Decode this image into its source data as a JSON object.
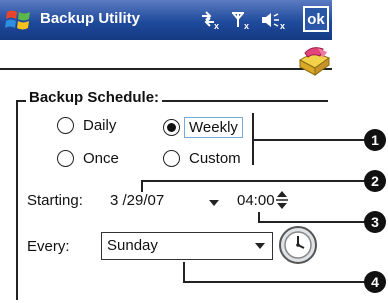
{
  "titlebar": {
    "title": "Backup Utility",
    "ok_label": "ok",
    "start_icon": "windows-flag-icon",
    "status_icons": [
      "connectivity-icon",
      "signal-icon",
      "volume-icon"
    ]
  },
  "header": {
    "icon": "backup-book-icon"
  },
  "schedule": {
    "group_label": "Backup Schedule:",
    "options": [
      {
        "label": "Daily",
        "checked": false
      },
      {
        "label": "Weekly",
        "checked": true
      },
      {
        "label": "Once",
        "checked": false
      },
      {
        "label": "Custom",
        "checked": false
      }
    ],
    "starting_label": "Starting:",
    "date_value": "3 /29/07",
    "time_value": "04:00",
    "every_label": "Every:",
    "every_value": "Sunday"
  },
  "callouts": [
    "1",
    "2",
    "3",
    "4"
  ]
}
